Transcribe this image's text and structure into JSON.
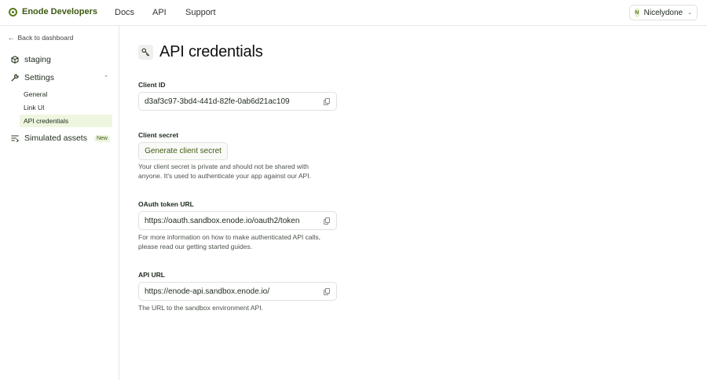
{
  "header": {
    "brand": "Enode Developers",
    "nav": {
      "docs": "Docs",
      "api": "API",
      "support": "Support"
    },
    "user": {
      "initial": "N",
      "name": "Nicelydone"
    }
  },
  "sidebar": {
    "back": "Back to dashboard",
    "items": {
      "staging": "staging",
      "settings": "Settings",
      "general": "General",
      "link_ui": "Link UI",
      "api_credentials": "API credentials",
      "simulated_assets": "Simulated assets",
      "new_badge": "New"
    }
  },
  "main": {
    "title": "API credentials",
    "client_id": {
      "label": "Client ID",
      "value": "d3af3c97-3bd4-441d-82fe-0ab6d21ac109"
    },
    "client_secret": {
      "label": "Client secret",
      "button": "Generate client secret",
      "help": "Your client secret is private and should not be shared with anyone. It's used to authenticate your app against our API."
    },
    "oauth": {
      "label": "OAuth token URL",
      "value": "https://oauth.sandbox.enode.io/oauth2/token",
      "help": "For more information on how to make authenticated API calls, please read our getting started guides."
    },
    "api_url": {
      "label": "API URL",
      "value": "https://enode-api.sandbox.enode.io/",
      "help": "The URL to the sandbox environment API."
    }
  },
  "colors": {
    "accent": "#3d5a12",
    "selected_bg": "#eef6df",
    "border": "#dfe2dc"
  }
}
